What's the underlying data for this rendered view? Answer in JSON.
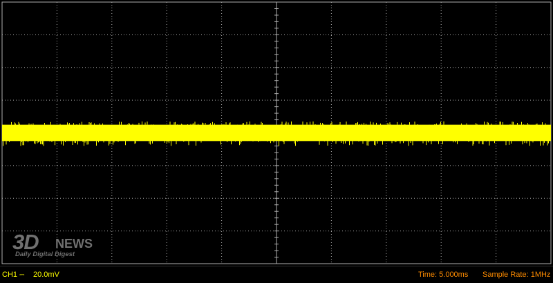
{
  "status_bar": {
    "channel": "CH1",
    "coupling_symbol": "⎓",
    "volts_per_div": "20.0mV",
    "timebase": "Time: 5.000ms",
    "sample_rate": "Sample Rate: 1MHz"
  },
  "watermark": {
    "logo_main": "3D",
    "logo_sub": "NEWS",
    "tagline": "Daily Digital Digest"
  },
  "colors": {
    "background": "#000000",
    "grid": "#b0b0b0",
    "trace": "#ffff00",
    "channel_text": "#ffff00",
    "time_text": "#ff8c00"
  },
  "chart_data": {
    "type": "line",
    "x_divisions": 10,
    "y_divisions": 8,
    "x_unit": "ms",
    "x_per_div": 5.0,
    "x_range": [
      0,
      50
    ],
    "y_unit": "mV",
    "y_per_div": 20.0,
    "y_range": [
      -80,
      80
    ],
    "grid": true,
    "series": [
      {
        "baseline_mV": 0,
        "band_mV": [
          -5,
          5
        ],
        "spike_max_mV": 7,
        "spike_min_mV": -8
      }
    ]
  }
}
